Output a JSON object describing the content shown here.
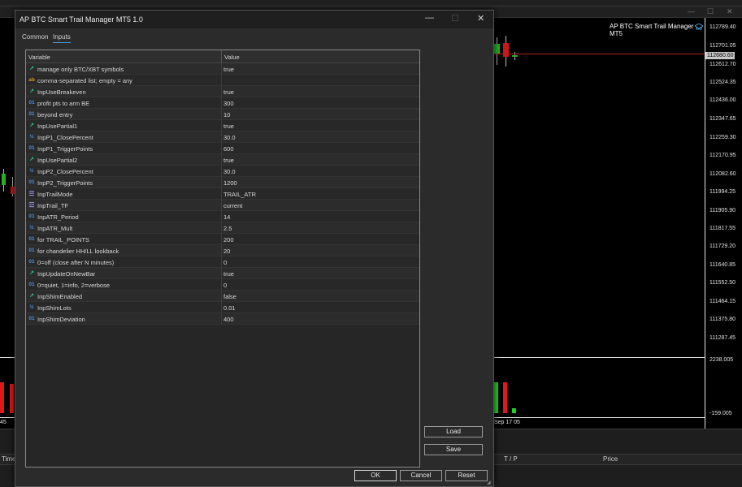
{
  "terminal": {
    "window_controls": [
      "—",
      "☐",
      "✕"
    ],
    "chart_title": "AP BTC Smart Trail Manager MT5",
    "current_price": "112680.60",
    "price_labels": [
      "112789.40",
      "112701.05",
      "112612.70",
      "112524.35",
      "112436.00",
      "112347.65",
      "112259.30",
      "112170.95",
      "112082.60",
      "111994.25",
      "111905.90",
      "111817.55",
      "111729.20",
      "111640.85",
      "111552.50",
      "111464.15",
      "111375.80",
      "111287.45"
    ],
    "sub_labels": [
      "2238.005",
      "-159.005"
    ],
    "time_labels": [
      "45",
      "Sep 17 05"
    ],
    "toolbox_columns": [
      "Time",
      "T / P",
      "Price"
    ]
  },
  "dialog": {
    "title": "AP BTC Smart Trail Manager MT5 1.0",
    "controls": {
      "minimize": "—",
      "maximize": "☐",
      "close": "✕"
    },
    "tabs": [
      {
        "label": "Common"
      },
      {
        "label": "Inputs"
      }
    ],
    "grid": {
      "col_variable": "Variable",
      "col_value": "Value",
      "rows": [
        {
          "type": "bool",
          "icon": "bool-icon",
          "name": "manage only BTC/XBT symbols",
          "value": "true"
        },
        {
          "type": "str",
          "icon": "string-icon",
          "name": "comma-separated list; empty = any",
          "value": ""
        },
        {
          "type": "bool",
          "icon": "bool-icon",
          "name": "InpUseBreakeven",
          "value": "true"
        },
        {
          "type": "int",
          "icon": "int-icon",
          "name": "profit pts to arm BE",
          "value": "300"
        },
        {
          "type": "int",
          "icon": "int-icon",
          "name": "beyond entry",
          "value": "10"
        },
        {
          "type": "bool",
          "icon": "bool-icon",
          "name": "InpUsePartial1",
          "value": "true"
        },
        {
          "type": "dbl",
          "icon": "double-icon",
          "name": "InpP1_ClosePercent",
          "value": "30.0"
        },
        {
          "type": "int",
          "icon": "int-icon",
          "name": "InpP1_TriggerPoints",
          "value": "600"
        },
        {
          "type": "bool",
          "icon": "bool-icon",
          "name": "InpUsePartial2",
          "value": "true"
        },
        {
          "type": "dbl",
          "icon": "double-icon",
          "name": "InpP2_ClosePercent",
          "value": "30.0"
        },
        {
          "type": "int",
          "icon": "int-icon",
          "name": "InpP2_TriggerPoints",
          "value": "1200"
        },
        {
          "type": "enum",
          "icon": "enum-icon",
          "name": "InpTrailMode",
          "value": "TRAIL_ATR"
        },
        {
          "type": "enum",
          "icon": "enum-icon",
          "name": "InpTrail_TF",
          "value": "current"
        },
        {
          "type": "int",
          "icon": "int-icon",
          "name": "InpATR_Period",
          "value": "14"
        },
        {
          "type": "dbl",
          "icon": "double-icon",
          "name": "InpATR_Mult",
          "value": "2.5"
        },
        {
          "type": "int",
          "icon": "int-icon",
          "name": "for TRAIL_POINTS",
          "value": "200"
        },
        {
          "type": "int",
          "icon": "int-icon",
          "name": "for chandelier HH/LL lookback",
          "value": "20"
        },
        {
          "type": "int",
          "icon": "int-icon",
          "name": "0=off (close after N minutes)",
          "value": "0"
        },
        {
          "type": "bool",
          "icon": "bool-icon",
          "name": "InpUpdateOnNewBar",
          "value": "true"
        },
        {
          "type": "int",
          "icon": "int-icon",
          "name": "0=quiet, 1=info, 2=verbose",
          "value": "0"
        },
        {
          "type": "bool",
          "icon": "bool-icon",
          "name": "InpShimEnabled",
          "value": "false"
        },
        {
          "type": "dbl",
          "icon": "double-icon",
          "name": "InpShimLots",
          "value": "0.01"
        },
        {
          "type": "int",
          "icon": "int-icon",
          "name": "InpShimDeviation",
          "value": "400"
        }
      ]
    },
    "buttons": {
      "load": "Load",
      "save": "Save",
      "ok": "OK",
      "cancel": "Cancel",
      "reset": "Reset"
    },
    "colors": {
      "bool_icon": "#27c27a",
      "numeric_icon": "#4f8fe0",
      "string_icon": "#d8952a",
      "enum_icon": "#8a8ad8",
      "tab_accent": "#4a9bd6"
    }
  }
}
